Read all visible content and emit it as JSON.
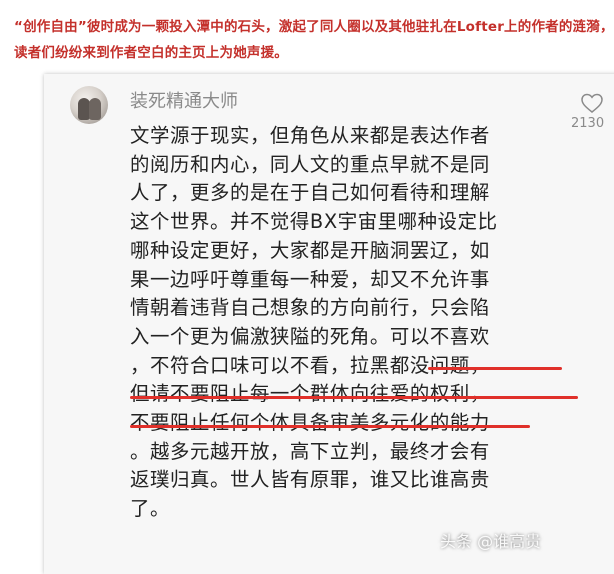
{
  "caption": "“创作自由”彼时成为一颗投入潭中的石头，激起了同人圈以及其他驻扎在Lofter上的作者的涟漪，读者们纷纷来到作者空白的主页上为她声援。",
  "comment": {
    "username": "装死精通大师",
    "like_count": "2130",
    "text": "文学源于现实，但角色从来都是表达作者\n的阅历和内心，同人文的重点早就不是同\n人了，更多的是在于自己如何看待和理解\n这个世界。并不觉得BX宇宙里哪种设定比\n哪种设定更好，大家都是开脑洞罢辽，如\n果一边呼吁尊重每一种爱，却又不允许事\n情朝着违背自己想象的方向前行，只会陷\n入一个更为偏激狭隘的死角。可以不喜欢\n，不符合口味可以不看，拉黑都没问题，\n但请不要阻止每一个群体向往爱的权利，\n不要阻止任何个体具备审美多元化的能力\n。越多元越开放，高下立判，最终才会有\n返璞归真。世人皆有原罪，谁又比谁高贵\n了。"
  },
  "watermark": "头条 @谁高贵",
  "icons": {
    "like": "heart-outline-icon",
    "avatar": "avatar-image"
  },
  "colors": {
    "caption": "#c4302b",
    "underline": "#e0302a",
    "text": "#222222",
    "meta": "#8a8a8a"
  }
}
